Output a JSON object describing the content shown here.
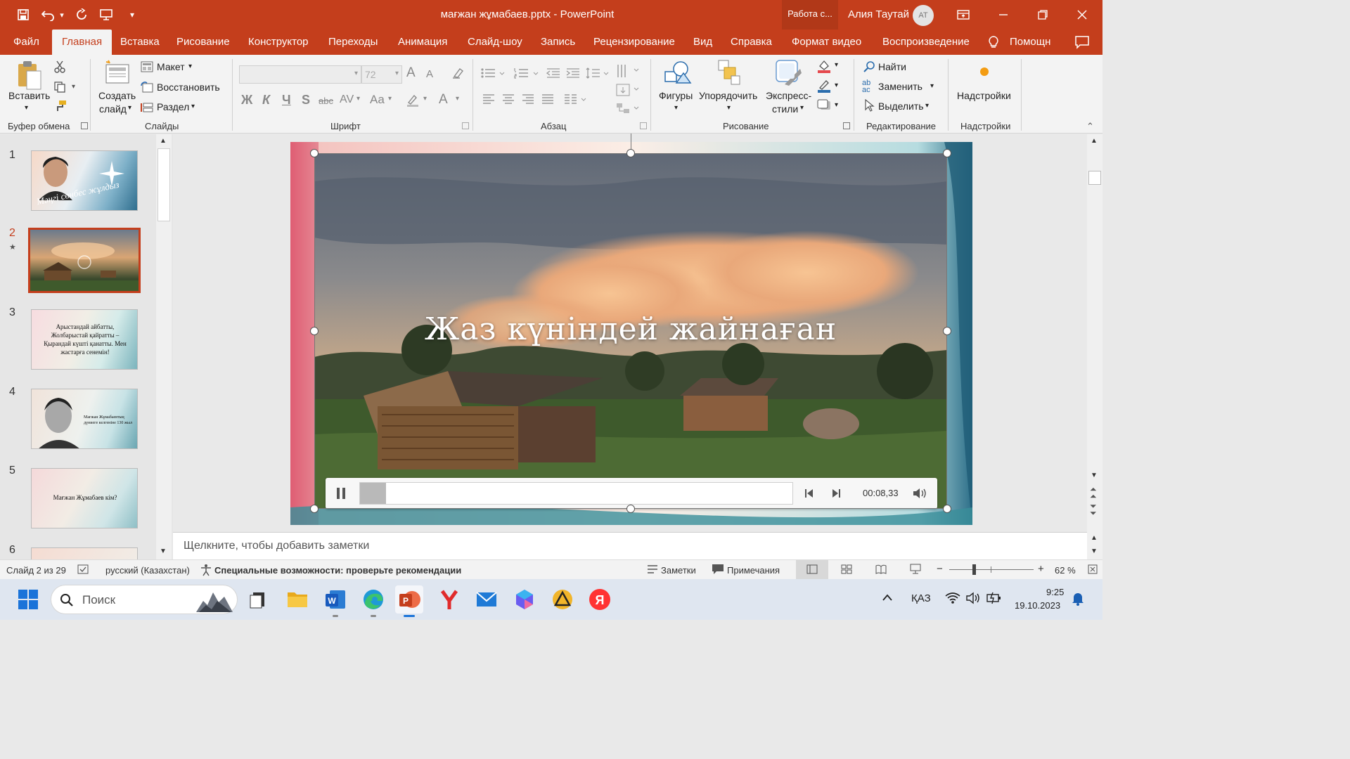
{
  "window": {
    "title": "мағжан жұмабаев.pptx  -  PowerPoint",
    "context_badge": "Работа с...",
    "user": "Алия Таутай",
    "user_initials": "AT",
    "accent": "#c43e1c"
  },
  "tabs": [
    "Файл",
    "Главная",
    "Вставка",
    "Рисование",
    "Конструктор",
    "Переходы",
    "Анимация",
    "Слайд-шоу",
    "Запись",
    "Рецензирование",
    "Вид",
    "Справка",
    "Формат видео",
    "Воспроизведение",
    "Помощн"
  ],
  "active_tab": "Главная",
  "ribbon": {
    "paste": "Вставить",
    "new_slide_1": "Создать",
    "new_slide_2": "слайд",
    "layout": "Макет",
    "reset": "Восстановить",
    "section": "Раздел",
    "font_size": "72",
    "bold": "Ж",
    "italic": "К",
    "underline": "Ч",
    "strike": "S",
    "abc": "abc",
    "av": "AV",
    "aa": "Aa",
    "font_grow": "A",
    "font_shrink": "A",
    "font_color_a": "A",
    "shapes": "Фигуры",
    "arrange": "Упорядочить",
    "quick_styles_1": "Экспресс-",
    "quick_styles_2": "стили",
    "find": "Найти",
    "replace": "Заменить",
    "select": "Выделить",
    "addins": "Надстройки",
    "groups": {
      "clipboard": "Буфер обмена",
      "slides": "Слайды",
      "font": "Шрифт",
      "paragraph": "Абзац",
      "drawing": "Рисование",
      "editing": "Редактирование",
      "addins": "Надстройки"
    }
  },
  "thumbnails": [
    {
      "num": "1",
      "text": "Мәңгі сөнбес жұлдыз"
    },
    {
      "num": "2",
      "text": ""
    },
    {
      "num": "3",
      "text": "Арыстандай айбатты, Жолбарыстай қайратты – Қырандай күшті қанатты. Мен жастарға сенемін!"
    },
    {
      "num": "4",
      "text": "Мағжан Жұмабаевтың дүниеге келгеніне 130 жыл"
    },
    {
      "num": "5",
      "text": "Мағжан Жұмабаев кім?"
    },
    {
      "num": "6",
      "text": ""
    }
  ],
  "video": {
    "title": "Жаз күніндей жайнаған",
    "time": "00:08,33",
    "progress": 0.06
  },
  "notes_placeholder": "Щелкните, чтобы добавить заметки",
  "status": {
    "slide": "Слайд 2 из 29",
    "language": "русский (Казахстан)",
    "accessibility": "Специальные возможности: проверьте рекомендации",
    "notes": "Заметки",
    "comments": "Примечания",
    "zoom_minus": "−",
    "zoom_plus": "+",
    "zoom": "62 %"
  },
  "taskbar": {
    "search": "Поиск",
    "lang": "ҚАЗ",
    "time": "9:25",
    "date": "19.10.2023"
  }
}
